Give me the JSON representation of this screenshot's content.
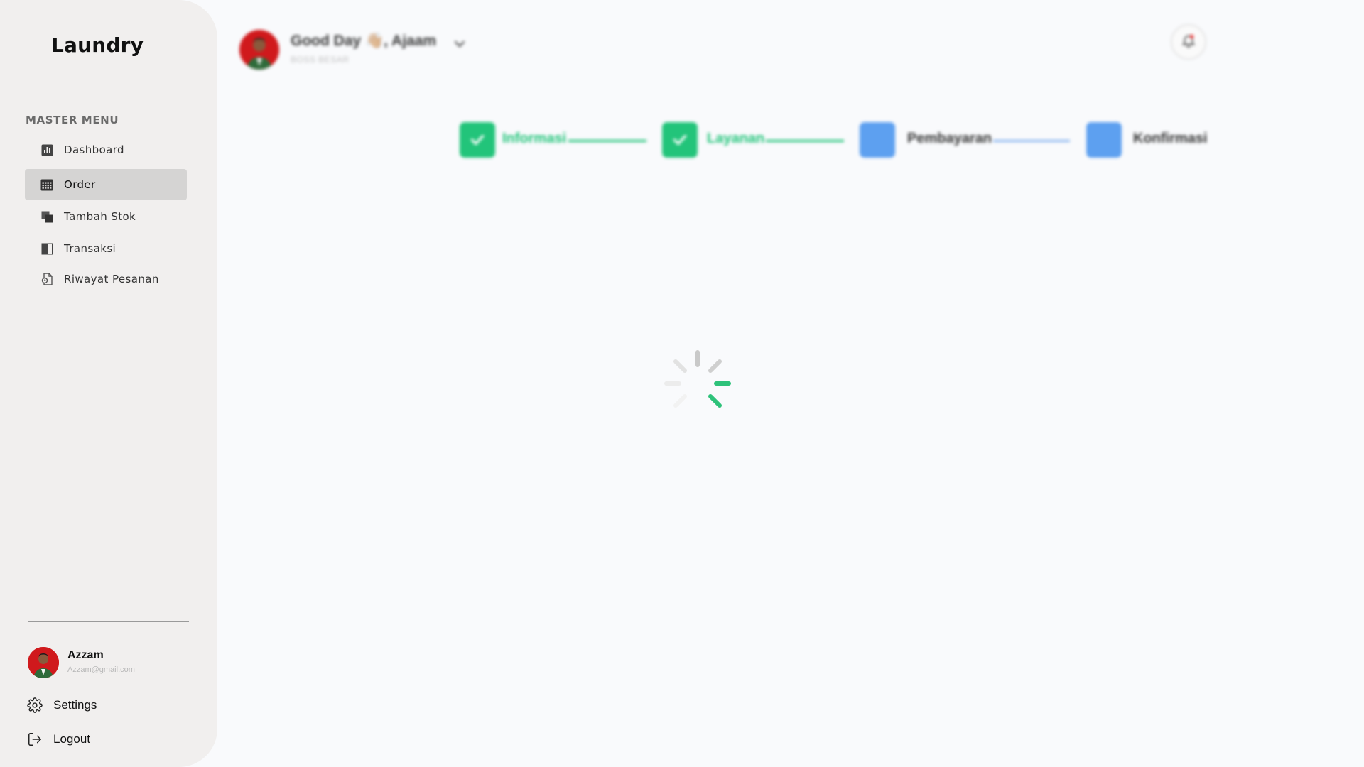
{
  "sidebar": {
    "brand": "Laundry",
    "menu_heading": "MASTER MENU",
    "items": [
      {
        "label": "Dashboard",
        "icon": "chart-icon"
      },
      {
        "label": "Order",
        "icon": "calendar-icon",
        "active": true
      },
      {
        "label": "Tambah Stok",
        "icon": "stack-icon"
      },
      {
        "label": "Transaksi",
        "icon": "book-icon"
      },
      {
        "label": "Riwayat Pesanan",
        "icon": "file-history-icon"
      }
    ],
    "profile": {
      "name": "Azzam",
      "email": "Azzam@gmail.com"
    },
    "settings_label": "Settings",
    "logout_label": "Logout"
  },
  "header": {
    "greeting": "Good Day 👋🏼, Ajaam",
    "role": "BOSS BESAR"
  },
  "stepper": [
    {
      "label": "Informasi",
      "status": "done"
    },
    {
      "label": "Layanan",
      "status": "done"
    },
    {
      "label": "Pembayaran",
      "status": "todo"
    },
    {
      "label": "Konfirmasi",
      "status": "todo"
    }
  ],
  "colors": {
    "done": "#22c47a",
    "todo": "#5da0f0",
    "sidebar_bg": "#f1efee",
    "active_item": "#d5d4d3"
  }
}
